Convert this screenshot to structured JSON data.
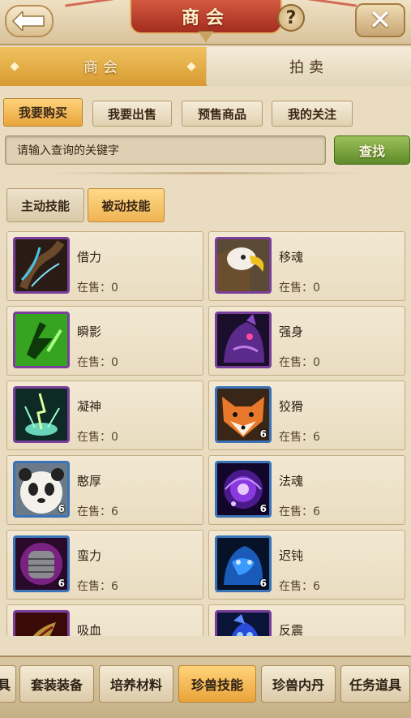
{
  "header": {
    "title": "商会",
    "help_label": "?",
    "close_label": "✕"
  },
  "top_tabs": [
    {
      "label": "商会",
      "active": true
    },
    {
      "label": "拍卖",
      "active": false
    }
  ],
  "sub_tabs": [
    {
      "label": "我要购买",
      "active": true
    },
    {
      "label": "我要出售",
      "active": false
    },
    {
      "label": "预售商品",
      "active": false
    },
    {
      "label": "我的关注",
      "active": false
    }
  ],
  "search": {
    "placeholder": "请输入查询的关键字",
    "button_label": "查找"
  },
  "skill_tabs": [
    {
      "label": "主动技能",
      "active": false
    },
    {
      "label": "被动技能",
      "active": true
    }
  ],
  "items": [
    {
      "name": "借力",
      "stock_label": "在售：0",
      "count": "",
      "frame": "purple",
      "icon": "tree-root-icon"
    },
    {
      "name": "移魂",
      "stock_label": "在售：0",
      "count": "",
      "frame": "purple",
      "icon": "eagle-icon"
    },
    {
      "name": "瞬影",
      "stock_label": "在售：0",
      "count": "",
      "frame": "purple",
      "icon": "shadow-step-icon"
    },
    {
      "name": "强身",
      "stock_label": "在售：0",
      "count": "",
      "frame": "purple",
      "icon": "demon-beast-icon"
    },
    {
      "name": "凝神",
      "stock_label": "在售：0",
      "count": "",
      "frame": "purple",
      "icon": "lightning-burst-icon"
    },
    {
      "name": "狡猾",
      "stock_label": "在售：6",
      "count": "6",
      "frame": "blue",
      "icon": "fox-icon"
    },
    {
      "name": "憨厚",
      "stock_label": "在售：6",
      "count": "6",
      "frame": "blue",
      "icon": "panda-icon"
    },
    {
      "name": "法魂",
      "stock_label": "在售：6",
      "count": "6",
      "frame": "blue",
      "icon": "purple-vortex-icon"
    },
    {
      "name": "蛮力",
      "stock_label": "在售：6",
      "count": "6",
      "frame": "blue",
      "icon": "fist-icon"
    },
    {
      "name": "迟钝",
      "stock_label": "在售：6",
      "count": "6",
      "frame": "blue",
      "icon": "blue-creature-icon"
    },
    {
      "name": "吸血",
      "stock_label": "",
      "count": "",
      "frame": "purple",
      "icon": "claw-icon"
    },
    {
      "name": "反震",
      "stock_label": "",
      "count": "",
      "frame": "purple",
      "icon": "blue-spirit-icon"
    }
  ],
  "categories": [
    {
      "label": "具",
      "active": false
    },
    {
      "label": "套装装备",
      "active": false
    },
    {
      "label": "培养材料",
      "active": false
    },
    {
      "label": "珍兽技能",
      "active": true
    },
    {
      "label": "珍兽内丹",
      "active": false
    },
    {
      "label": "任务道具",
      "active": false
    }
  ]
}
